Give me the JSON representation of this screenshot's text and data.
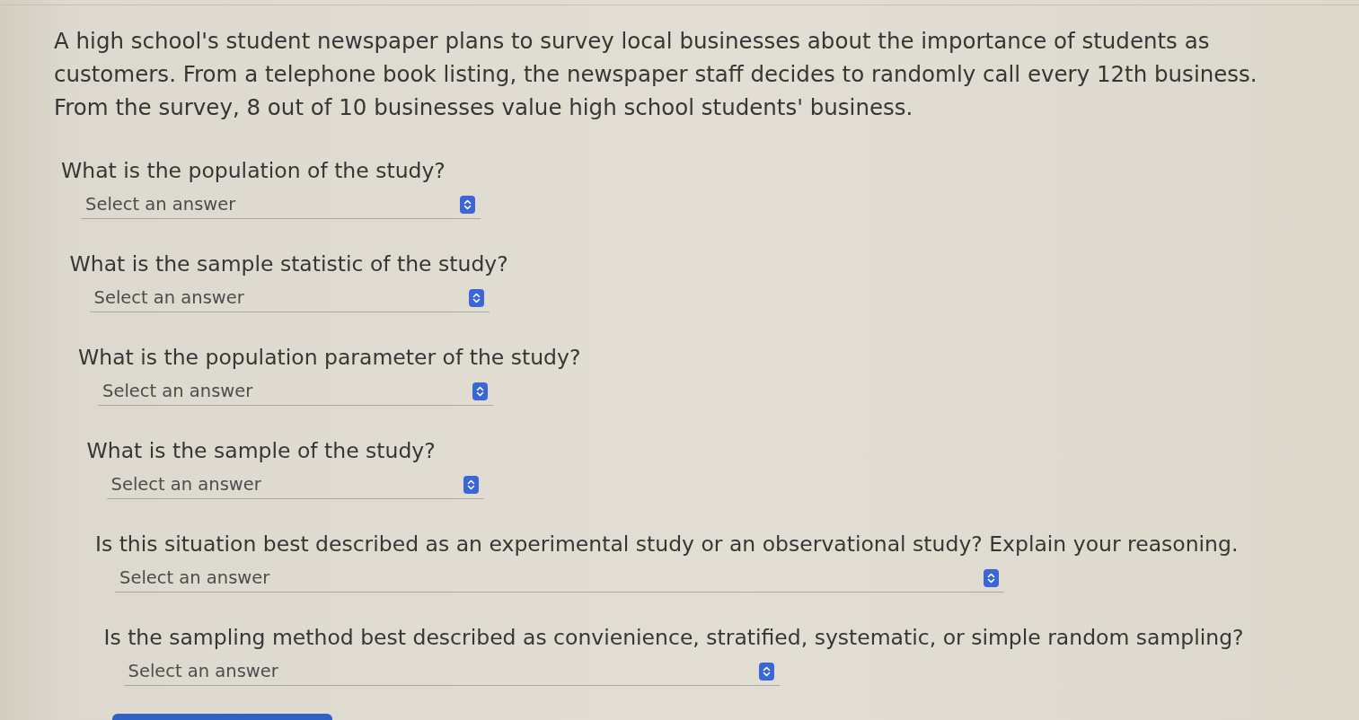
{
  "intro": "A high school's student newspaper plans to survey local businesses about the importance of students as\ncustomers. From a telephone book listing, the newspaper staff decides to randomly call every 12th business.\nFrom the survey, 8 out of 10 businesses value high school students' business.",
  "questions": [
    {
      "text": "What is the population of the study?",
      "answer": {
        "placeholder": "Select an answer"
      }
    },
    {
      "text": "What is the sample statistic of the study?",
      "answer": {
        "placeholder": "Select an answer"
      }
    },
    {
      "text": "What is the population parameter of the study?",
      "answer": {
        "placeholder": "Select an answer"
      }
    },
    {
      "text": "What is the sample of the study?",
      "answer": {
        "placeholder": "Select an answer"
      }
    },
    {
      "text": "Is this situation best described as an experimental study or an observational study? Explain your reasoning.",
      "answer": {
        "placeholder": "Select an answer"
      }
    },
    {
      "text": "Is the sampling method best described as convienience, stratified, systematic, or simple random sampling?",
      "answer": {
        "placeholder": "Select an answer"
      }
    }
  ]
}
